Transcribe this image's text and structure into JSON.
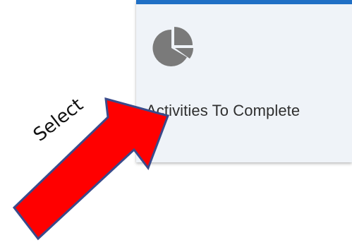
{
  "tile": {
    "label": "Activities To Complete",
    "icon": "pie-chart-icon",
    "accent_color": "#1f6fc5",
    "background_color": "#eff3f8"
  },
  "annotation": {
    "text": "Select",
    "arrow_color": "#ff0000",
    "arrow_outline_color": "#3a4a8a"
  }
}
